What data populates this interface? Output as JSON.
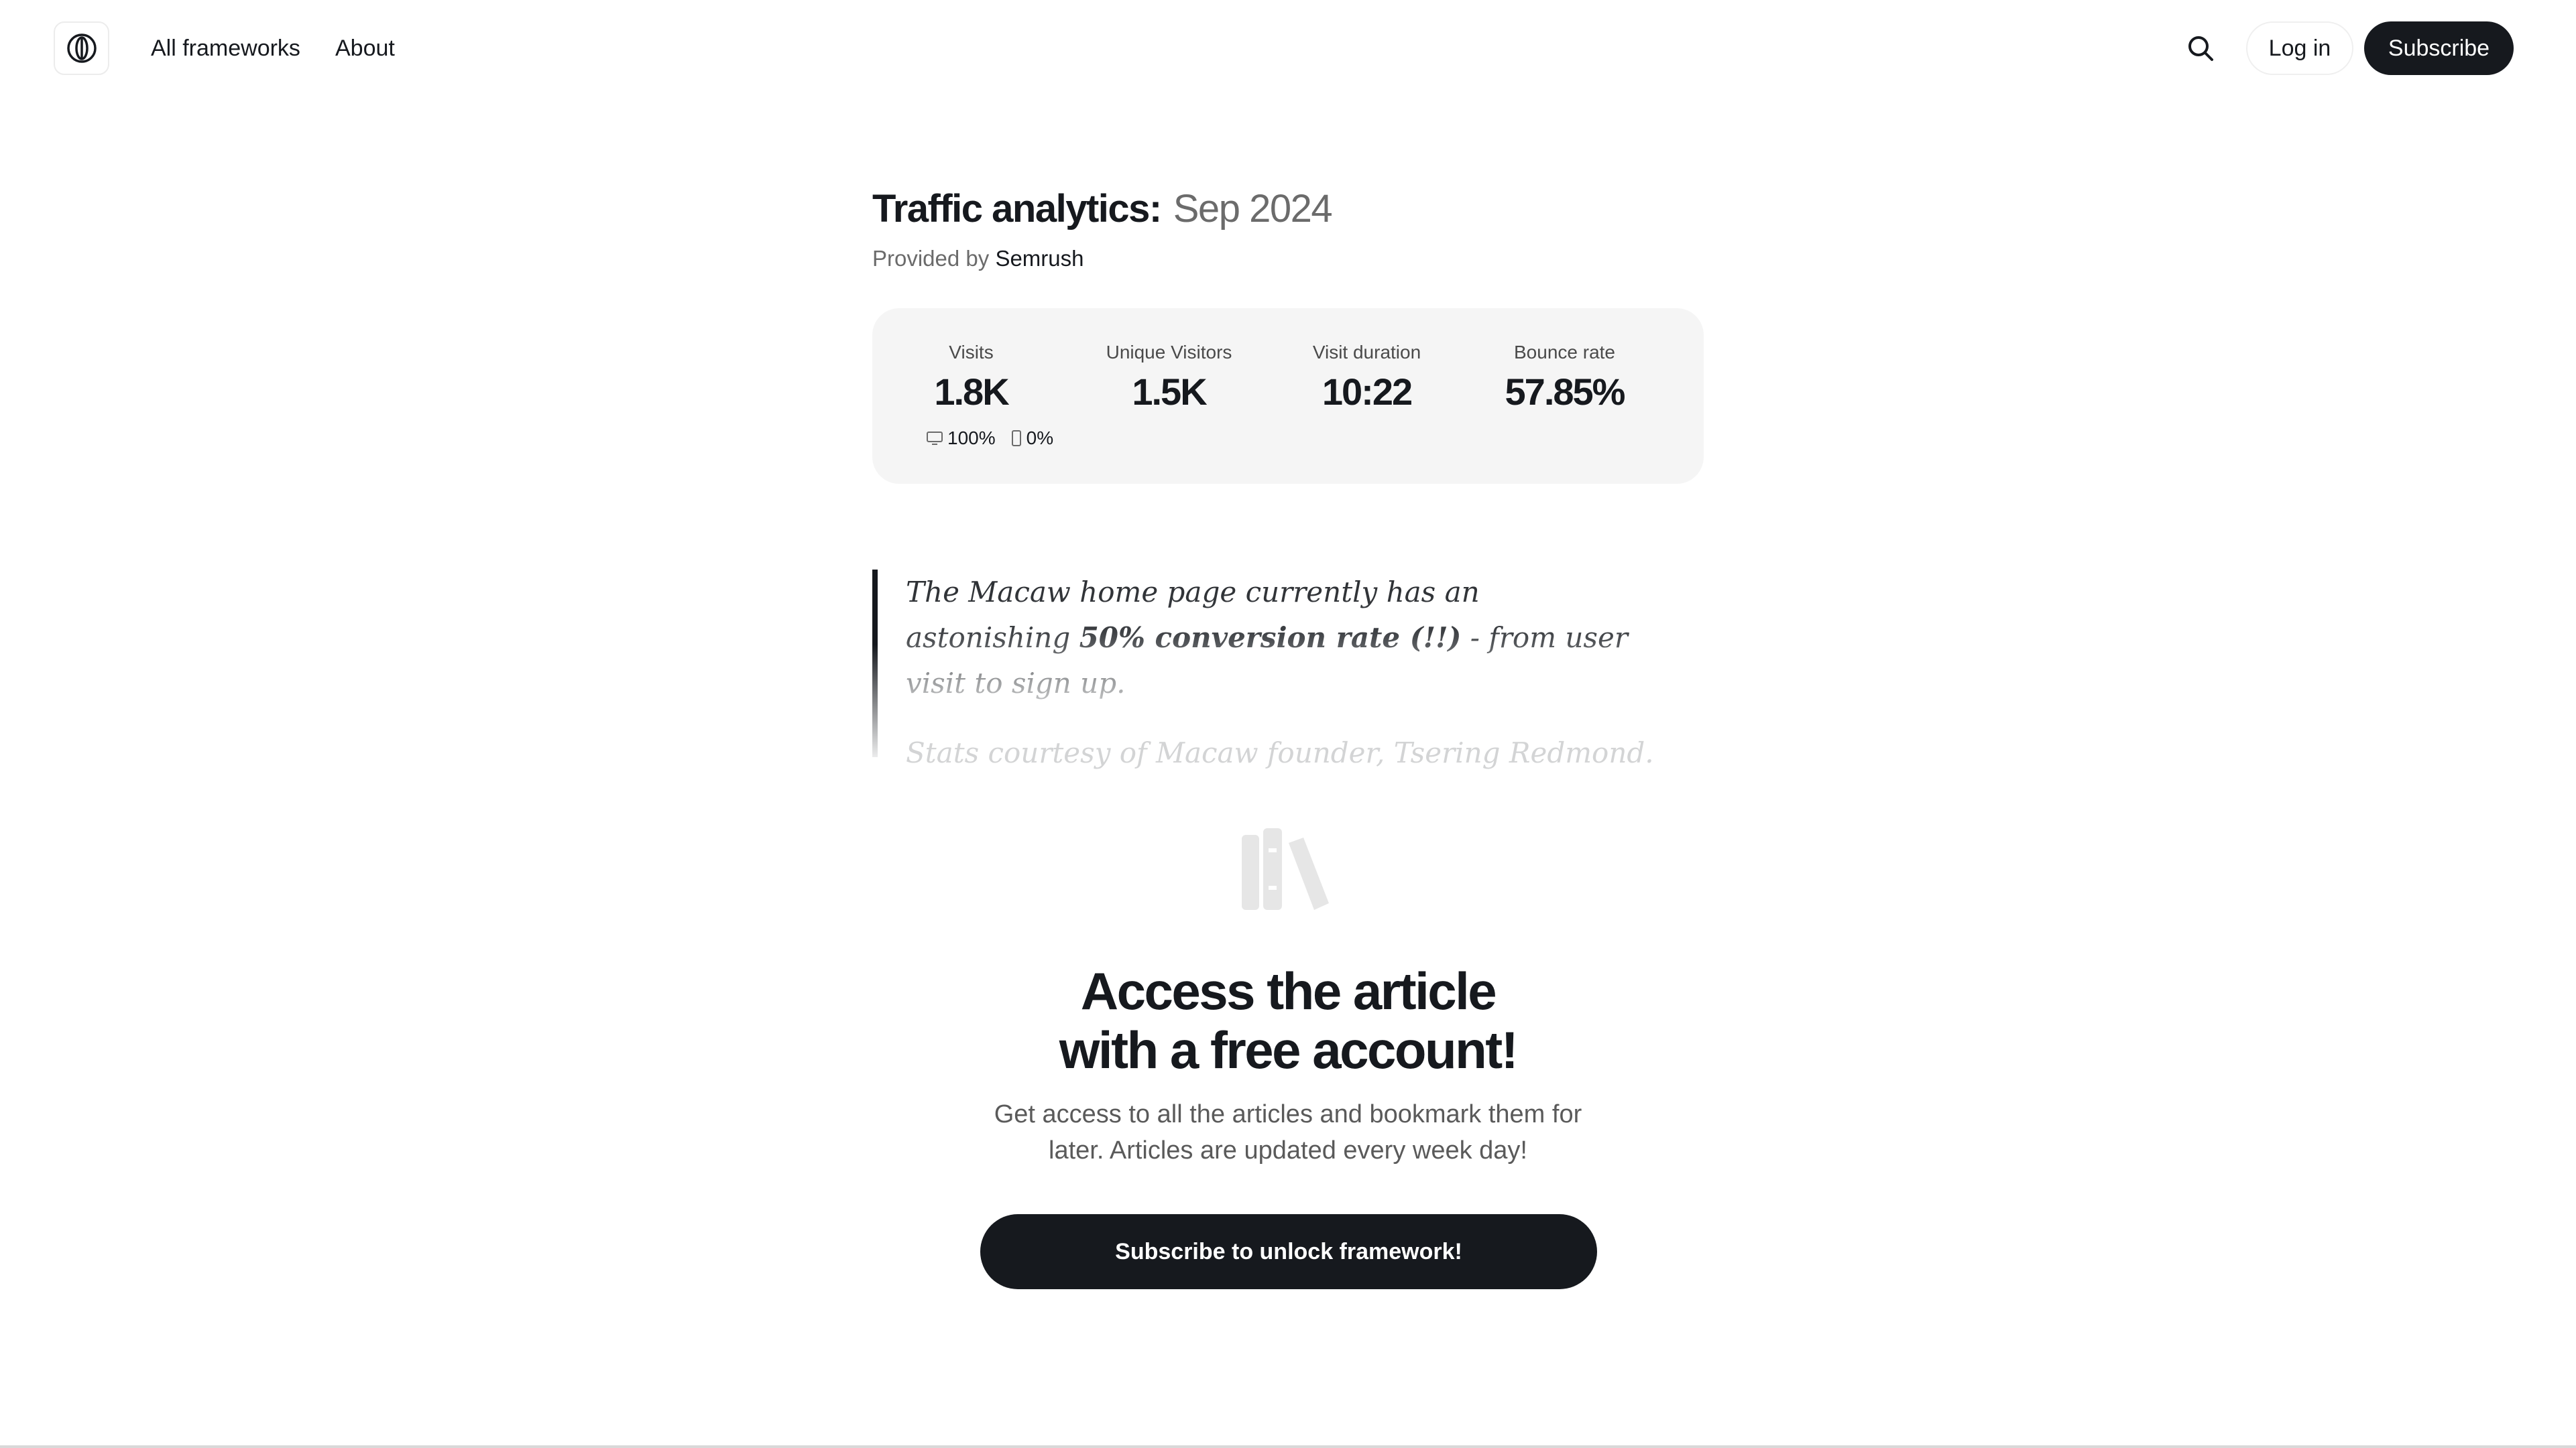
{
  "header": {
    "logo_icon": "portal-logo-icon",
    "nav": [
      {
        "label": "All frameworks"
      },
      {
        "label": "About"
      }
    ],
    "search_icon": "search-icon",
    "login_label": "Log in",
    "subscribe_label": "Subscribe"
  },
  "article": {
    "title": "Traffic analytics:",
    "date": "Sep 2024",
    "provided_prefix": "Provided by",
    "provider": "Semrush"
  },
  "stats": [
    {
      "label": "Visits",
      "value": "1.8K"
    },
    {
      "label": "Unique Visitors",
      "value": "1.5K"
    },
    {
      "label": "Visit duration",
      "value": "10:22"
    },
    {
      "label": "Bounce rate",
      "value": "57.85%"
    }
  ],
  "devices": {
    "desktop": "100%",
    "mobile": "0%"
  },
  "quote": {
    "text_start": "The Macaw home page currently has an astonishing ",
    "text_bold": "50% conversion rate (!!)",
    "text_end": " - from user visit to sign up.",
    "credit": "Stats courtesy of Macaw founder, Tsering Redmond."
  },
  "cta": {
    "icon": "books-icon",
    "title_line1": "Access the article",
    "title_line2": "with a free account!",
    "subtitle_line1": "Get access to all the articles and bookmark them for",
    "subtitle_line2": "later. Articles are updated every week day!",
    "button_label": "Subscribe to unlock framework!"
  },
  "colors": {
    "primary": "#16191e",
    "muted": "#6b6b6b",
    "card_bg": "#f5f5f5"
  }
}
